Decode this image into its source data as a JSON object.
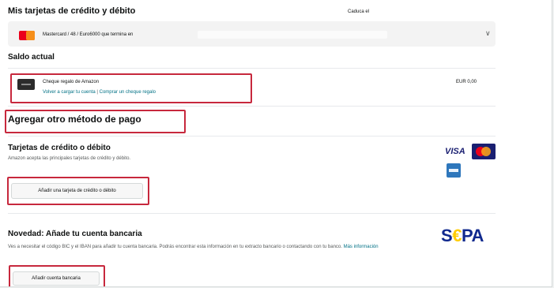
{
  "header": {
    "title": "Mis tarjetas de crédito y débito",
    "right_label": "Caduca el"
  },
  "saved_card": {
    "text": "Mastercard / 48 / Euro6000 que termina en"
  },
  "balance": {
    "title": "Saldo actual",
    "gift_card_name": "Cheque regalo de Amazon",
    "link_recharge": "Volver a cargar tu cuenta",
    "separator": "|",
    "link_buy": "Comprar un cheque regalo",
    "amount": "EUR 0,00"
  },
  "add_method": {
    "title": "Agregar otro método de pago"
  },
  "credit_cards": {
    "title": "Tarjetas de crédito o débito",
    "subtitle": "Amazon acepta las principales tarjetas de crédito y débito.",
    "button": "Añadir una tarjeta de crédito o débito"
  },
  "bank_account": {
    "title": "Novedad: Añade tu cuenta bancaria",
    "description": "Ves a necesitar el código BIC y el IBAN para añadir tu cuenta bancaria. Podrás encontrar esta información en tu extracto bancario o contactando con tu banco.",
    "link": "Más información",
    "button": "Añadir cuenta bancaria"
  },
  "logos": {
    "visa": "VISA",
    "sepa_s": "S",
    "sepa_e": "€",
    "sepa_rest": "PA"
  }
}
